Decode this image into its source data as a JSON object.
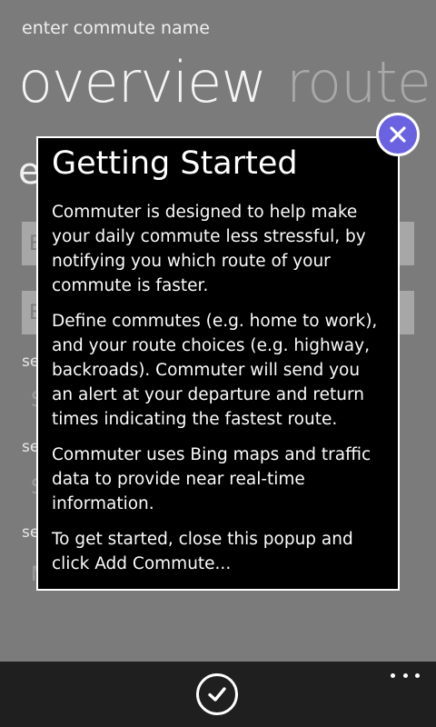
{
  "header": {
    "subtitle": "enter commute name",
    "pivot_items": [
      "overview",
      "route"
    ]
  },
  "background": {
    "heading_initial": "e",
    "input_initials": [
      "E",
      "E"
    ],
    "label_initials": [
      "se",
      "se",
      "se"
    ],
    "value_initials": [
      "S",
      "S",
      "M"
    ]
  },
  "popup": {
    "title": "Getting Started",
    "paragraphs": [
      "Commuter is designed to help make your daily commute less stressful, by notifying you which route of your commute is faster.",
      "Define commutes (e.g. home to work), and your route choices (e.g. highway, backroads). Commuter will send you an alert at your departure and return times indicating the fastest route.",
      "Commuter uses Bing maps and traffic data to provide near real-time information.",
      "To get started, close this popup and click Add Commute..."
    ],
    "close_icon": "close-icon"
  },
  "app_bar": {
    "confirm_icon": "check-icon",
    "more_icon": "ellipsis-icon"
  },
  "colors": {
    "background_dim": "#7b7b7b",
    "popup_background": "#000000",
    "close_button_fill": "#6a62e0",
    "app_bar": "#1f1f1f"
  }
}
